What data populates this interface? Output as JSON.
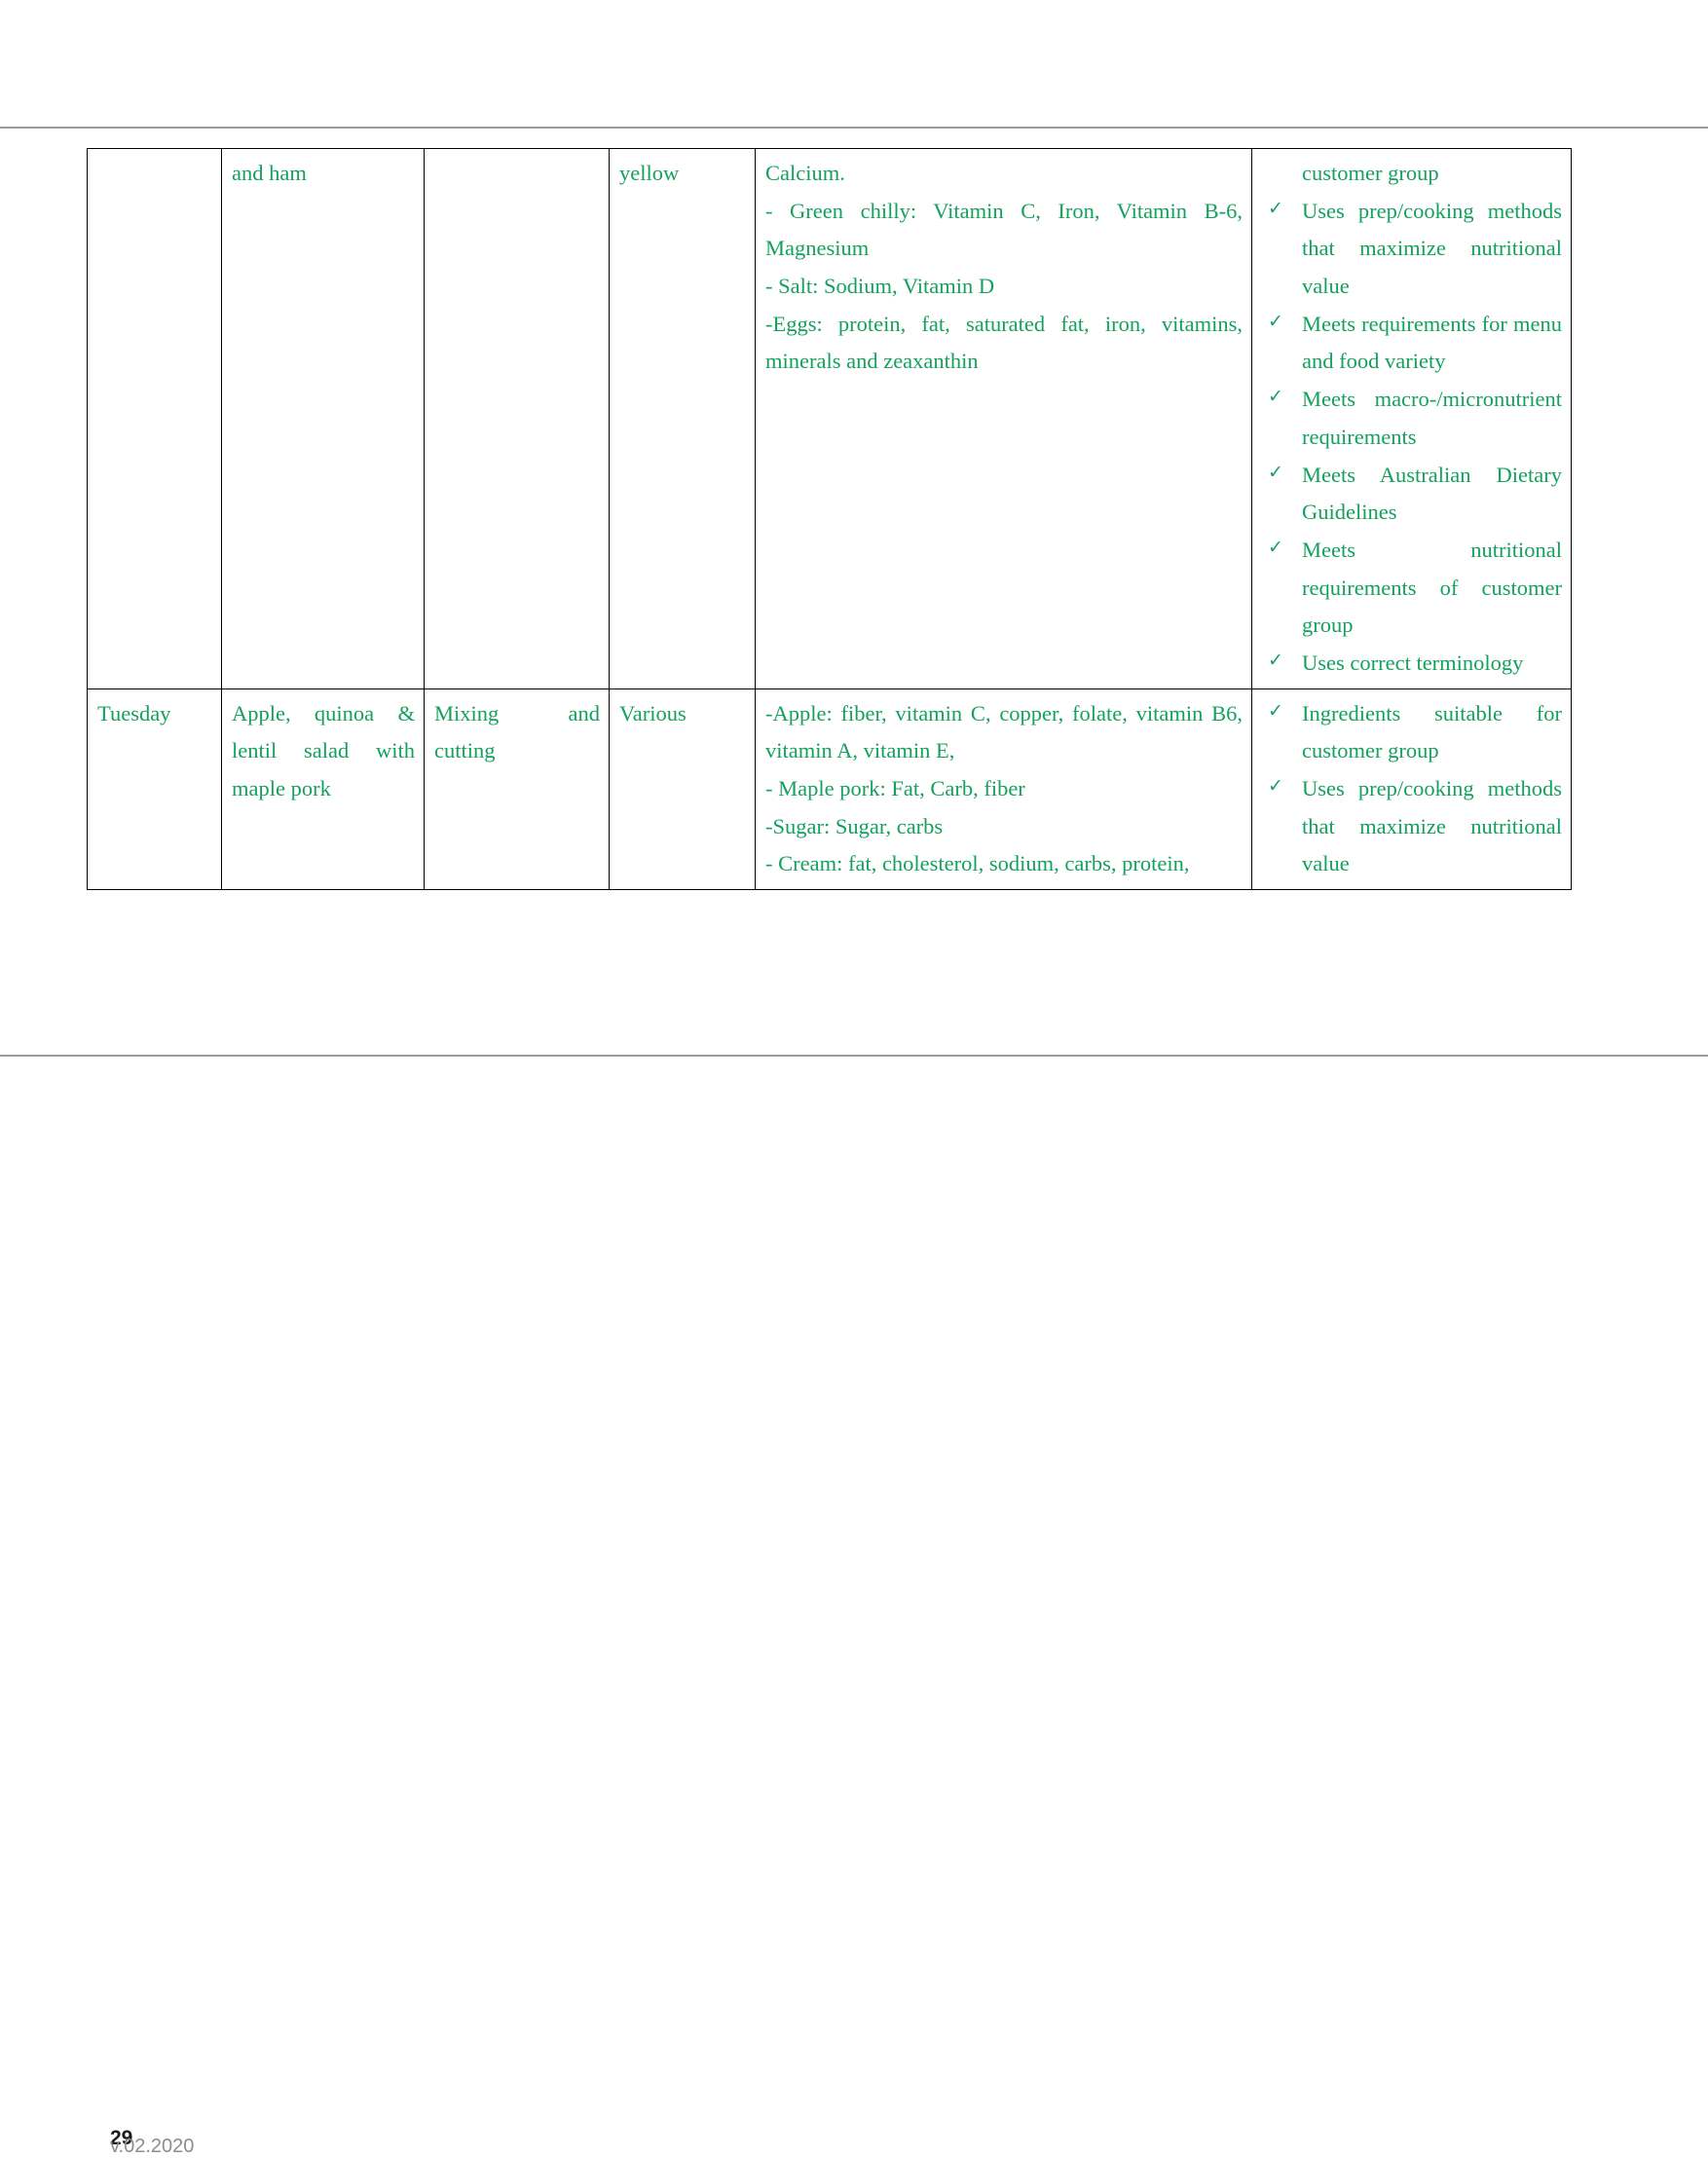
{
  "document": {
    "footer": {
      "page_number": "29",
      "version": "v.02.2020"
    }
  },
  "table": {
    "rows": [
      {
        "day": "",
        "dish": "and ham",
        "method": "",
        "colour": "yellow",
        "nutrition": [
          "Calcium.",
          "- Green chilly: Vitamin C, Iron, Vitamin B-6, Magnesium",
          "- Salt: Sodium, Vitamin D",
          "-Eggs: protein, fat, saturated fat, iron, vitamins, minerals and zeaxanthin"
        ],
        "checklist_continuation": "customer group",
        "checklist": [
          "Uses prep/cooking methods that maximize nutritional value",
          "Meets requirements for menu and food variety",
          "Meets macro-/micronutrient requirements",
          "Meets Australian Dietary Guidelines",
          "Meets nutritional requirements of customer group",
          "Uses correct terminology"
        ]
      },
      {
        "day": "Tuesday",
        "dish": "Apple, quinoa & lentil salad with maple pork",
        "method": "Mixing and cutting",
        "colour": "Various",
        "nutrition": [
          "-Apple: fiber, vitamin C, copper, folate, vitamin B6, vitamin A, vitamin E,",
          "- Maple pork: Fat, Carb, fiber",
          "-Sugar: Sugar, carbs",
          "- Cream: fat, cholesterol, sodium, carbs, protein,"
        ],
        "checklist_continuation": "",
        "checklist": [
          "Ingredients suitable for customer group",
          "Uses prep/cooking methods that maximize nutritional value"
        ]
      }
    ],
    "tick_glyph": "✓"
  },
  "colors": {
    "text_green": "#15a05e",
    "border_black": "#000000",
    "rule_gray": "#9a9a9a"
  }
}
